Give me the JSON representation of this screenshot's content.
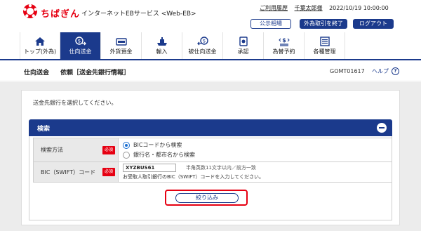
{
  "header": {
    "brand": "ちばぎん",
    "service_name": "インターネットEBサービス <Web-EB>",
    "usage_history_link": "ご利用履歴",
    "user_name": "千葉太郎様",
    "datetime": "2022/10/19 10:00:00",
    "buttons": {
      "public_rates": "公示相場",
      "end_fx": "外為取引を終了",
      "logout": "ログアウト"
    },
    "brand_color": "#e60012",
    "accent_color": "#1b3a8c"
  },
  "nav": {
    "items": [
      {
        "label": "トップ(外為)",
        "icon": "home-icon",
        "active": false
      },
      {
        "label": "仕向送金",
        "icon": "remittance-icon",
        "active": true
      },
      {
        "label": "外貨預金",
        "icon": "deposit-icon",
        "active": false
      },
      {
        "label": "輸入",
        "icon": "import-icon",
        "active": false
      },
      {
        "label": "被仕向送金",
        "icon": "incoming-remittance-icon",
        "active": false
      },
      {
        "label": "承認",
        "icon": "approval-icon",
        "active": false
      },
      {
        "label": "為替予約",
        "icon": "fx-contract-icon",
        "active": false
      },
      {
        "label": "各種管理",
        "icon": "management-icon",
        "active": false
      }
    ]
  },
  "page": {
    "section": "仕向送金",
    "title": "依頼［送金先銀行情報］",
    "screen_id": "GOMT01617",
    "help_label": "ヘルプ",
    "help_icon": "help-icon"
  },
  "content": {
    "instruction": "送金先銀行を選択してください。",
    "search": {
      "title": "検索",
      "method_label": "検索方法",
      "required_badge": "必須",
      "options": [
        {
          "label": "BICコードから検索",
          "checked": true
        },
        {
          "label": "銀行名・都市名から検索",
          "checked": false
        }
      ],
      "bic_label": "BIC（SWIFT）コード",
      "bic_value": "XYZBUS61",
      "bic_note": "半角英数11文字以内／前方一致",
      "bic_help": "お受取人取引銀行のBIC（SWIFT）コードを入力してください。",
      "submit_label": "絞り込み"
    }
  }
}
